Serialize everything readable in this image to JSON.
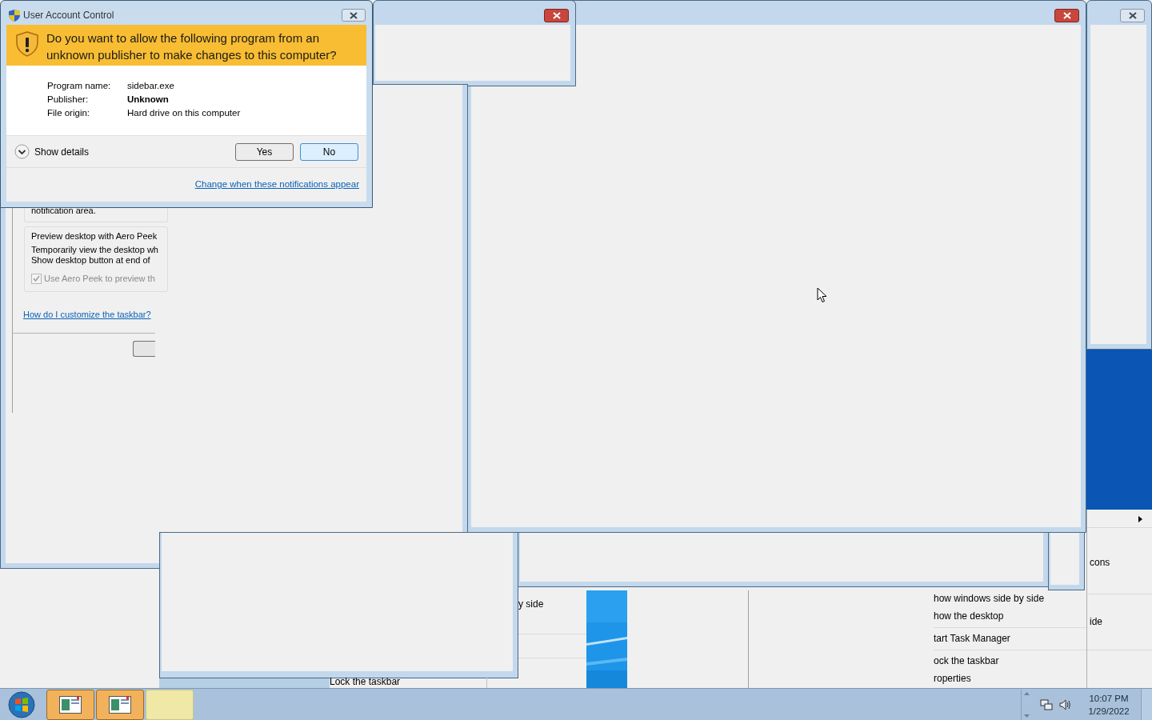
{
  "uac": {
    "title": "User Account Control",
    "question": "Do you want to allow the following program from an unknown publisher to make changes to this computer?",
    "fields": [
      {
        "label": "Program name:",
        "value": "sidebar.exe",
        "bold": false
      },
      {
        "label": "Publisher:",
        "value": "Unknown",
        "bold": true
      },
      {
        "label": "File origin:",
        "value": "Hard drive on this computer",
        "bold": false
      }
    ],
    "details_toggle": "Show details",
    "buttons": [
      {
        "label": "Yes",
        "selected": false
      },
      {
        "label": "No",
        "selected": true
      }
    ],
    "link": "Change when these notifications appear"
  },
  "background_windows": [
    {
      "close_highlighted": true
    },
    {
      "close_highlighted": true
    },
    {
      "close_highlighted": false
    }
  ],
  "taskbar_properties": {
    "notification_text": "notification area.",
    "group_title": "Preview desktop with Aero Peek",
    "description_lines": [
      "Temporarily view the desktop wh",
      "Show desktop button at end of"
    ],
    "checkbox": {
      "label": "Use Aero Peek to preview th",
      "checked": true,
      "disabled": true
    },
    "link": "How do I customize the taskbar?"
  },
  "fragments": {
    "left_menu_text": "y side",
    "bottom_menu_text": "Lock the taskbar",
    "right_panel_rows": [
      "cons",
      "ide"
    ]
  },
  "context_menu": {
    "items": [
      {
        "label": "how windows side by side",
        "separator_after": false
      },
      {
        "label": "how the desktop",
        "separator_after": true
      },
      {
        "label": "tart Task Manager",
        "separator_after": true
      },
      {
        "label": "ock the taskbar",
        "separator_after": false
      },
      {
        "label": "roperties",
        "separator_after": false
      }
    ]
  },
  "taskbar": {
    "buttons": [
      {
        "kind": "app",
        "highlighted": true
      },
      {
        "kind": "app",
        "highlighted": true
      },
      {
        "kind": "blank",
        "highlighted": false
      }
    ],
    "clock": {
      "time": "10:07 PM",
      "date": "1/29/2022"
    }
  }
}
